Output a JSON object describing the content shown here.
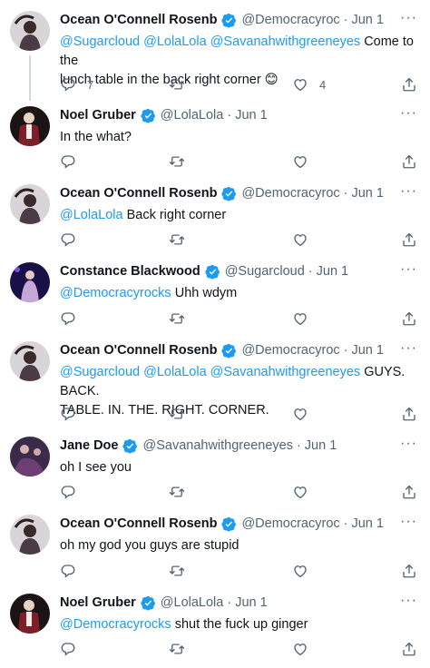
{
  "colors": {
    "accent": "#1d9bf0",
    "text": "#0f1419",
    "muted": "#536471",
    "line": "#cfd9de"
  },
  "tweets": [
    {
      "name": "Ocean O'Connell Rosenb",
      "handle": "@Democracyroc",
      "date": "Jun 1",
      "mentions": "@Sugarcloud @LolaLola @Savanahwithgreeneyes",
      "text_line1": "Come to the",
      "text_line2": "lunch table in the back right corner 😊",
      "reply_count": "7",
      "like_count": "4"
    },
    {
      "name": "Noel Gruber",
      "handle": "@LolaLola",
      "date": "Jun 1",
      "mentions": "",
      "text": "In the what?"
    },
    {
      "name": "Ocean O'Connell Rosenb",
      "handle": "@Democracyroc",
      "date": "Jun 1",
      "mentions": "@LolaLola",
      "text": "Back right corner"
    },
    {
      "name": "Constance Blackwood",
      "handle": "@Sugarcloud",
      "date": "Jun 1",
      "mentions": "@Democracyrocks",
      "text": "Uhh wdym"
    },
    {
      "name": "Ocean O'Connell Rosenb",
      "handle": "@Democracyroc",
      "date": "Jun 1",
      "mentions": "@Sugarcloud @LolaLola @Savanahwithgreeneyes",
      "text_line1": "GUYS. BACK.",
      "text_line2": "TABLE. IN. THE. RIGHT. CORNER."
    },
    {
      "name": "Jane Doe",
      "handle": "@Savanahwithgreeneyes",
      "date": "Jun 1",
      "mentions": "",
      "text": "oh I see you"
    },
    {
      "name": "Ocean O'Connell Rosenb",
      "handle": "@Democracyroc",
      "date": "Jun 1",
      "mentions": "",
      "text": "oh my god you guys are stupid"
    },
    {
      "name": "Noel Gruber",
      "handle": "@LolaLola",
      "date": "Jun 1",
      "mentions": "@Democracyrocks",
      "text": "shut the fuck up ginger"
    }
  ],
  "icons": {
    "reply": "reply-icon",
    "retweet": "retweet-icon",
    "like": "heart-icon",
    "share": "share-icon",
    "more": "more-icon",
    "verified": "verified-badge-icon"
  },
  "dot": "·",
  "more_glyph": "···"
}
